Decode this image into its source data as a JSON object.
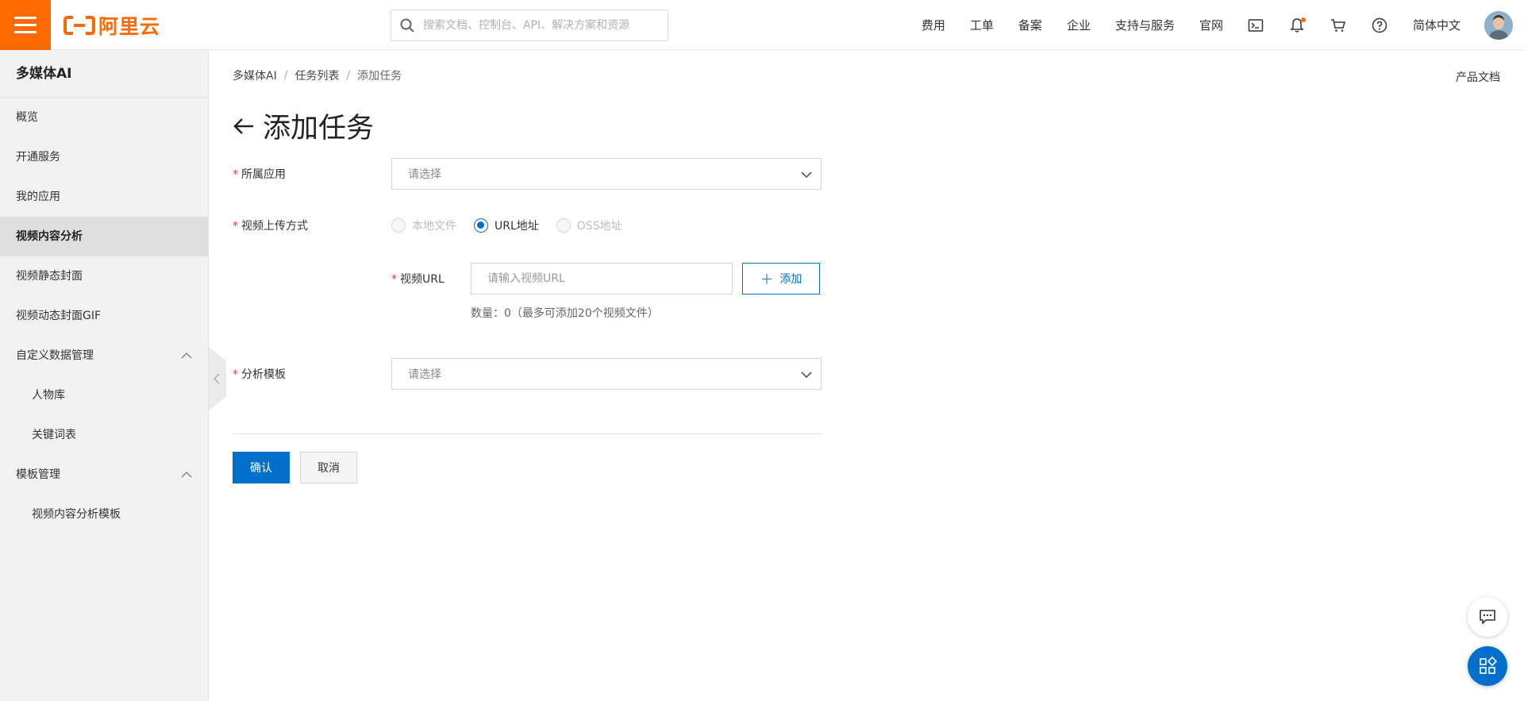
{
  "header": {
    "logo_text": "阿里云",
    "search_placeholder": "搜索文档、控制台、API、解决方案和资源",
    "nav": [
      "费用",
      "工单",
      "备案",
      "企业",
      "支持与服务",
      "官网"
    ],
    "language": "简体中文"
  },
  "colors": {
    "brand": "#ff6a00",
    "primary": "#0070cc",
    "required": "#e23c3c"
  },
  "sidebar": {
    "title": "多媒体AI",
    "items": [
      {
        "label": "概览"
      },
      {
        "label": "开通服务"
      },
      {
        "label": "我的应用"
      },
      {
        "label": "视频内容分析",
        "active": true
      },
      {
        "label": "视频静态封面"
      },
      {
        "label": "视频动态封面GIF"
      },
      {
        "label": "自定义数据管理",
        "expanded": true
      },
      {
        "label": "人物库"
      },
      {
        "label": "关键词表"
      },
      {
        "label": "模板管理",
        "expanded": true
      },
      {
        "label": "视频内容分析模板"
      }
    ]
  },
  "breadcrumb": [
    "多媒体AI",
    "任务列表",
    "添加任务"
  ],
  "doc_link": "产品文档",
  "page_title": "添加任务",
  "form": {
    "app_label": "所属应用",
    "app_placeholder": "请选择",
    "upload_label": "视频上传方式",
    "upload_options": [
      {
        "label": "本地文件",
        "state": "disabled"
      },
      {
        "label": "URL地址",
        "state": "checked"
      },
      {
        "label": "OSS地址",
        "state": "disabled"
      }
    ],
    "url_label": "视频URL",
    "url_placeholder": "请输入视频URL",
    "add_button": "添加",
    "count_hint": "数量：0（最多可添加20个视频文件）",
    "template_label": "分析模板",
    "template_placeholder": "请选择",
    "confirm": "确认",
    "cancel": "取消"
  }
}
